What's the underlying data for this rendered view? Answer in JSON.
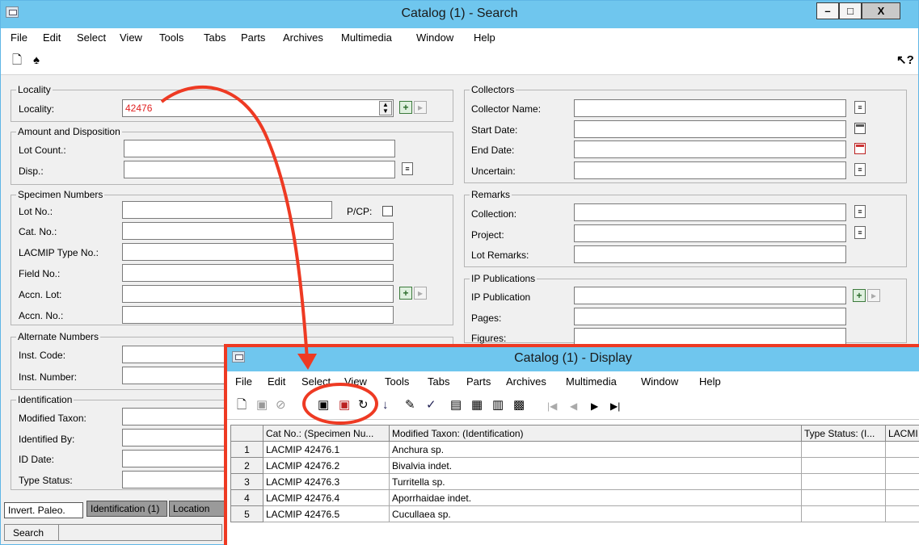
{
  "main": {
    "title": "Catalog (1) - Search",
    "menu": [
      "File",
      "Edit",
      "Select",
      "View",
      "Tools",
      "Tabs",
      "Parts",
      "Archives",
      "Multimedia",
      "Window",
      "Help"
    ],
    "window_buttons": {
      "min": "–",
      "max": "□",
      "close": "X"
    },
    "groups": {
      "locality": {
        "title": "Locality",
        "label": "Locality:",
        "value": "42476"
      },
      "amount": {
        "title": "Amount and Disposition",
        "lot_count": "Lot Count.:",
        "disp": "Disp.:"
      },
      "specimen": {
        "title": "Specimen Numbers",
        "lot_no": "Lot No.:",
        "pcp": "P/CP:",
        "cat_no": "Cat. No.:",
        "lacmip_type": "LACMIP Type No.:",
        "field_no": "Field No.:",
        "accn_lot": "Accn. Lot:",
        "accn_no": "Accn. No.:"
      },
      "alternate": {
        "title": "Alternate Numbers",
        "inst_code": "Inst. Code:",
        "inst_number": "Inst. Number:"
      },
      "identification": {
        "title": "Identification",
        "modified_taxon": "Modified Taxon:",
        "identified_by": "Identified By:",
        "id_date": "ID Date:",
        "type_status": "Type Status:"
      },
      "collectors": {
        "title": "Collectors",
        "collector_name": "Collector Name:",
        "start_date": "Start Date:",
        "end_date": "End Date:",
        "uncertain": "Uncertain:"
      },
      "remarks": {
        "title": "Remarks",
        "collection": "Collection:",
        "project": "Project:",
        "lot_remarks": "Lot Remarks:"
      },
      "publications": {
        "title": "IP Publications",
        "ip_publication": "IP Publication",
        "pages": "Pages:",
        "figures": "Figures:"
      }
    },
    "tabs": [
      "Invert. Paleo.",
      "Identification (1)",
      "Location"
    ],
    "status": "Search"
  },
  "display": {
    "title": "Catalog (1) - Display",
    "menu": [
      "File",
      "Edit",
      "Select",
      "View",
      "Tools",
      "Tabs",
      "Parts",
      "Archives",
      "Multimedia",
      "Window",
      "Help"
    ],
    "columns": [
      "",
      "Cat No.: (Specimen Nu...",
      "Modified Taxon: (Identification)",
      "Type Status: (I...",
      "LACMI"
    ],
    "rows": [
      {
        "n": "1",
        "cat": "LACMIP 42476.1",
        "taxon": "Anchura sp."
      },
      {
        "n": "2",
        "cat": "LACMIP 42476.2",
        "taxon": "Bivalvia indet."
      },
      {
        "n": "3",
        "cat": "LACMIP 42476.3",
        "taxon": "Turritella sp."
      },
      {
        "n": "4",
        "cat": "LACMIP 42476.4",
        "taxon": "Aporrhaidae indet."
      },
      {
        "n": "5",
        "cat": "LACMIP 42476.5",
        "taxon": "Cucullaea sp."
      }
    ]
  },
  "colors": {
    "titlebar": "#6fc6ee",
    "annotation": "#ee3a23",
    "locality_value": "#e02020"
  }
}
